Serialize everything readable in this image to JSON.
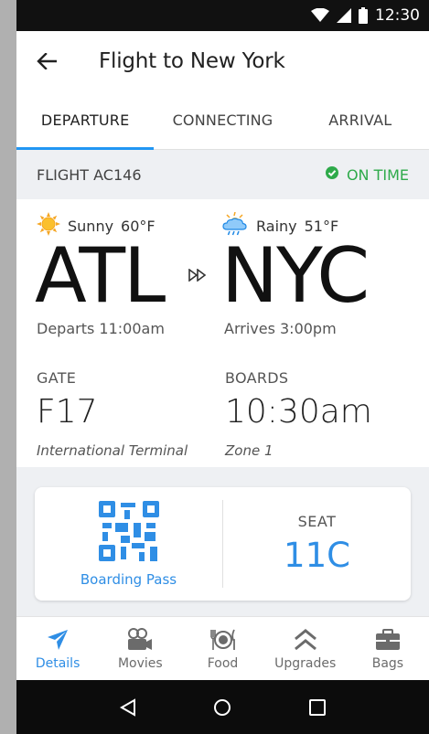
{
  "status_bar": {
    "time": "12:30"
  },
  "app_bar": {
    "title": "Flight to New York"
  },
  "tabs": [
    {
      "label": "DEPARTURE",
      "active": true
    },
    {
      "label": "CONNECTING",
      "active": false
    },
    {
      "label": "ARRIVAL",
      "active": false
    }
  ],
  "flight": {
    "number": "FLIGHT AC146",
    "status": "ON TIME",
    "status_color": "#2eaa4a"
  },
  "departure": {
    "weather": "Sunny",
    "temp": "60°F",
    "code": "ATL",
    "time_text": "Departs 11:00am",
    "gate_label": "GATE",
    "gate": "F17",
    "terminal": "International Terminal"
  },
  "arrival": {
    "weather": "Rainy",
    "temp": "51°F",
    "code": "NYC",
    "time_text": "Arrives 3:00pm",
    "boards_label": "BOARDS",
    "boards": "10:30am",
    "zone": "Zone 1"
  },
  "boarding_card": {
    "pass_label": "Boarding Pass",
    "seat_label": "SEAT",
    "seat": "11C"
  },
  "bottom_nav": [
    {
      "label": "Details",
      "icon": "airplane-icon",
      "active": true
    },
    {
      "label": "Movies",
      "icon": "movie-camera-icon",
      "active": false
    },
    {
      "label": "Food",
      "icon": "plate-icon",
      "active": false
    },
    {
      "label": "Upgrades",
      "icon": "chevrons-up-icon",
      "active": false
    },
    {
      "label": "Bags",
      "icon": "briefcase-icon",
      "active": false
    }
  ],
  "colors": {
    "accent": "#2f8ee5",
    "tab_indicator": "#2196f3",
    "strip_bg": "#eef0f3"
  }
}
